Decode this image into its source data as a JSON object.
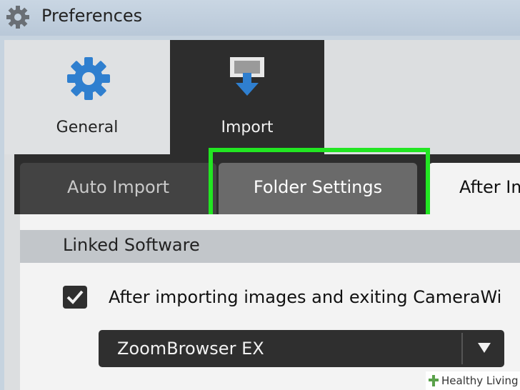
{
  "window": {
    "title": "Preferences",
    "title_icon": "gear-icon"
  },
  "categories": [
    {
      "label": "General",
      "icon": "gear-icon",
      "selected": false
    },
    {
      "label": "Import",
      "icon": "import-icon",
      "selected": true
    }
  ],
  "subtabs": [
    {
      "label": "Auto Import",
      "selected": false
    },
    {
      "label": "Folder Settings",
      "selected": true,
      "highlighted": true
    },
    {
      "label": "After Im",
      "selected": false
    }
  ],
  "section": {
    "heading": "Linked Software"
  },
  "option": {
    "checked": true,
    "label": "After importing images and exiting CameraWi"
  },
  "linked_app_select": {
    "value": "ZoomBrowser EX"
  },
  "watermark": {
    "text": "Healthy Living"
  },
  "colors": {
    "highlight": "#22e622",
    "gear_blue": "#2f7fcf",
    "dark_tab": "#2d2d2d"
  }
}
